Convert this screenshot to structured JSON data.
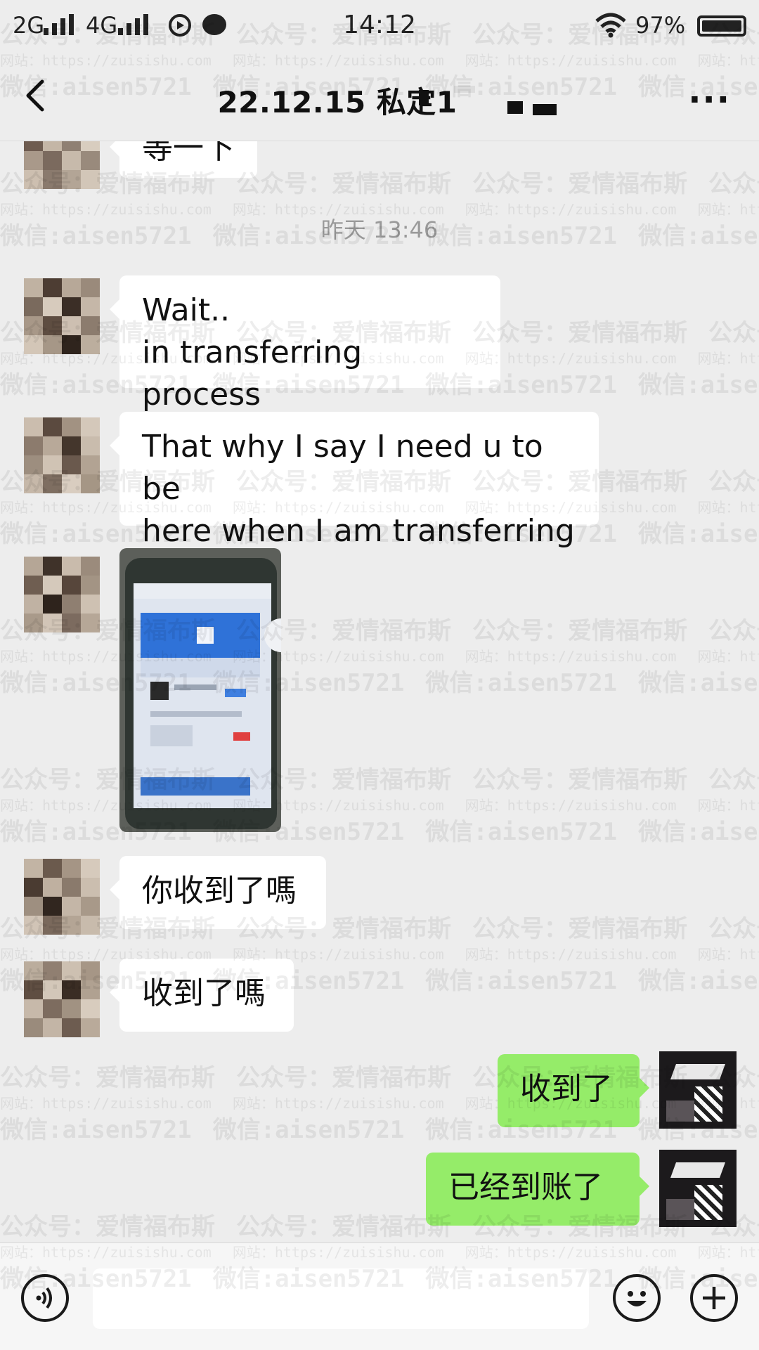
{
  "status_bar": {
    "network_1": "2G",
    "network_2": "4G",
    "time": "14:12",
    "battery": "97%"
  },
  "header": {
    "title": "22.12.15 私定1",
    "more_label": "..."
  },
  "chat": {
    "partial_message": "等一下",
    "timestamp": "昨天 13:46",
    "messages": [
      {
        "side": "in",
        "lines": [
          "Wait..",
          "in transferring process"
        ]
      },
      {
        "side": "in",
        "lines": [
          "That why I say I need u to be",
          "here when I am transferring"
        ]
      },
      {
        "side": "in",
        "type": "image",
        "icon": "phone-screenshot-image"
      },
      {
        "side": "in",
        "lines": [
          "你收到了嗎"
        ]
      },
      {
        "side": "in",
        "lines": [
          "收到了嗎"
        ]
      },
      {
        "side": "out",
        "lines": [
          "收到了"
        ]
      },
      {
        "side": "out",
        "lines": [
          "已经到账了"
        ]
      }
    ]
  },
  "input_bar": {
    "voice_icon": "voice-icon",
    "emoji_icon": "emoji-icon",
    "plus_icon": "plus-icon"
  },
  "watermark": {
    "line_a": "公众号：爱情福布斯",
    "line_b": "网站：https://zuisishu.com",
    "line_c": "微信:aisen5721"
  }
}
